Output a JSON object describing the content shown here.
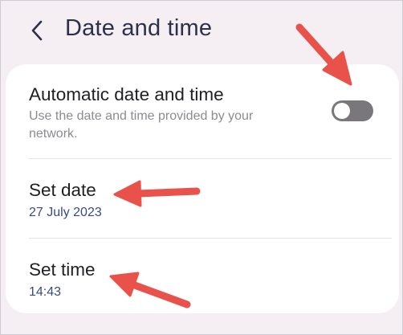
{
  "header": {
    "back_icon": "chevron-left-icon",
    "title": "Date and time"
  },
  "settings": {
    "automatic": {
      "title": "Automatic date and time",
      "description": "Use the date and time provided by your network.",
      "toggle_on": false
    },
    "set_date": {
      "title": "Set date",
      "value": "27 July 2023"
    },
    "set_time": {
      "title": "Set time",
      "value": "14:43"
    }
  },
  "annotations": {
    "arrow_color": "#e8524a",
    "arrow_targets": [
      "automatic-date-time-toggle",
      "set-date-row",
      "set-time-row"
    ]
  },
  "colors": {
    "background": "#f5eef2",
    "card": "#ffffff",
    "title_text": "#2c3149",
    "value_text": "#3c4a80",
    "toggle_track_off": "#79777c"
  }
}
